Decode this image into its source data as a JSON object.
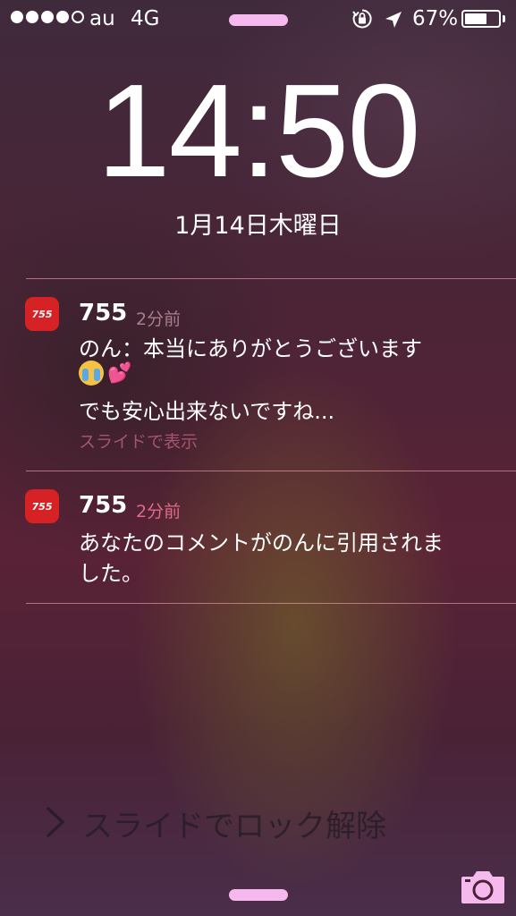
{
  "status_bar": {
    "signal_bars_filled": 4,
    "signal_bars_total": 5,
    "carrier": "au",
    "network": "4G",
    "battery_percent": "67%",
    "battery_level": 0.67,
    "icons": [
      "orientation-lock-icon",
      "location-arrow-icon",
      "battery-icon"
    ]
  },
  "lockscreen": {
    "time": "14:50",
    "date": "1月14日木曜日"
  },
  "notifications": [
    {
      "app": "755",
      "app_icon_text": "755",
      "time_ago": "2分前",
      "lines": [
        "のん：本当にありがとうございます",
        "でも安心出来ないですね..."
      ],
      "emoji": [
        "crying-face",
        "two-hearts"
      ],
      "action": "スライドで表示"
    },
    {
      "app": "755",
      "app_icon_text": "755",
      "time_ago": "2分前",
      "lines": [
        "あなたのコメントがのんに引用されま",
        "した。"
      ]
    }
  ],
  "unlock": {
    "label": "スライドでロック解除"
  },
  "colors": {
    "app_icon": "#d62125",
    "grabber": "#f5b9ee",
    "camera": "#f5b9ee"
  }
}
